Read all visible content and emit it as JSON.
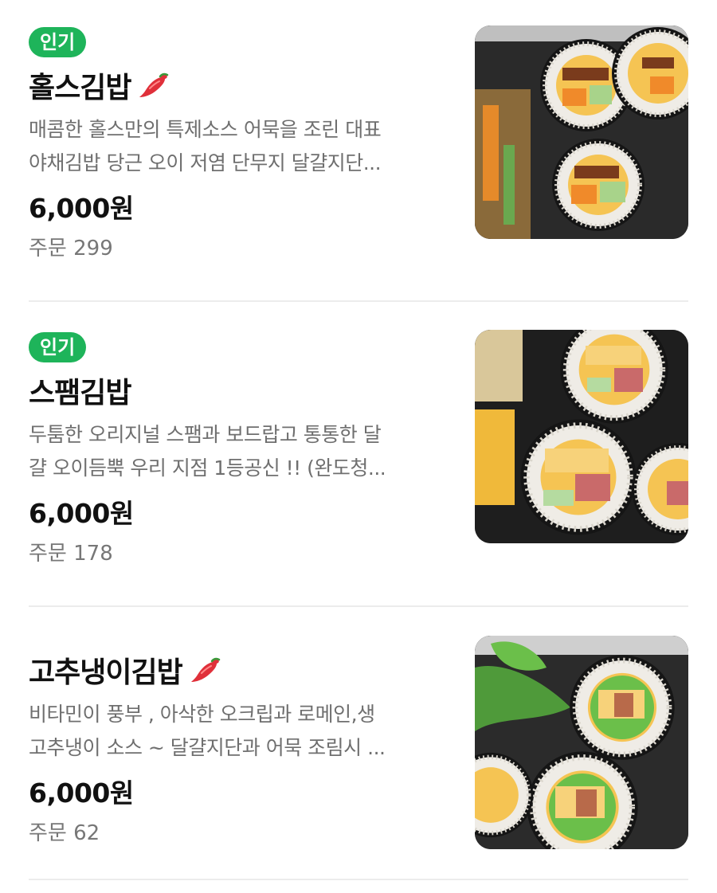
{
  "menu": {
    "items": [
      {
        "badge": "인기",
        "title": "홀스김밥",
        "spicy_icon": "chili-pepper-icon",
        "desc_line1": "매콤한 홀스만의 특제소스 어묵을 조린 대표",
        "desc_line2": "야채김밥 당근 오이 저염 단무지 달걀지단...",
        "price": "6,000원",
        "orders": "주문 299"
      },
      {
        "badge": "인기",
        "title": "스팸김밥",
        "desc_line1": "두툼한 오리지널 스팸과 보드랍고 통통한 달",
        "desc_line2": "걀 오이듬뿍 우리 지점 1등공신 !! (완도청...",
        "price": "6,000원",
        "orders": "주문 178"
      },
      {
        "title": "고추냉이김밥",
        "spicy_icon": "chili-pepper-icon",
        "desc_line1": "비타민이 풍부 , 아삭한 오크립과 로메인,생",
        "desc_line2": "고추냉이 소스 ~ 달걀지단과 어묵 조림시 ...",
        "price": "6,000원",
        "orders": "주문 62"
      }
    ]
  },
  "colors": {
    "badge_green": "#1eb45a",
    "divider": "#ececec",
    "desc_gray": "#6f6f6f",
    "chili_red": "#e0303a"
  }
}
